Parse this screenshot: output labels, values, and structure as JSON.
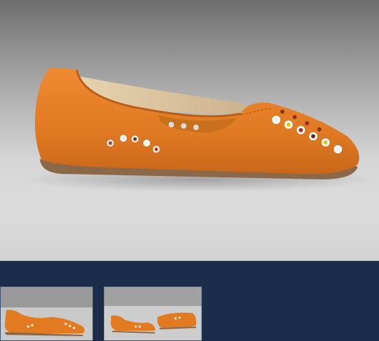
{
  "gallery": {
    "main_image": "orange-suede-loafer",
    "thumbnails": [
      {
        "name": "thumbnail-1",
        "view": "side"
      },
      {
        "name": "thumbnail-2",
        "view": "pair"
      }
    ]
  },
  "colors": {
    "strip_background": "#1b2c48",
    "shoe_suede": "#e27a22",
    "sole": "#8a6848"
  }
}
